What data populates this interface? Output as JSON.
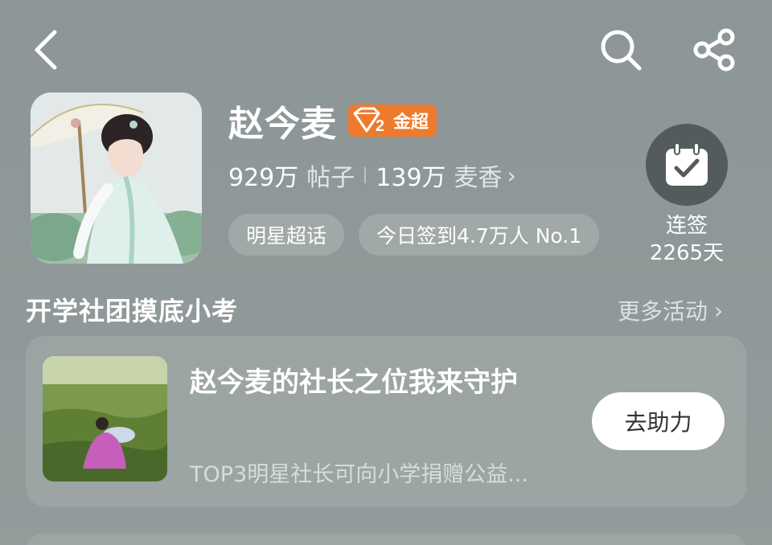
{
  "header": {
    "back_icon": "back-chevron-icon",
    "search_icon": "search-icon",
    "share_icon": "share-icon"
  },
  "profile": {
    "name": "赵今麦",
    "badge_label": "金超",
    "badge_level": "2",
    "posts_count": "929万",
    "posts_label": "帖子",
    "fans_count": "139万",
    "fans_label": "麦香",
    "fans_chevron": "›",
    "tags": [
      "明星超话",
      "今日签到4.7万人 No.1"
    ]
  },
  "checkin": {
    "label_line1": "连签",
    "label_line2": "2265天"
  },
  "section": {
    "title": "开学社团摸底小考",
    "more_label": "更多活动",
    "more_chevron": "›"
  },
  "activity_card": {
    "title": "赵今麦的社长之位我来守护",
    "subtitle": "TOP3明星社长可向小学捐赠公益...",
    "button_label": "去助力"
  },
  "colors": {
    "background": "#8f9898",
    "badge": "#ee7a2e",
    "checkin_circle": "#545b5c"
  }
}
